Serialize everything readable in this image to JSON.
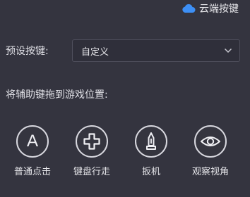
{
  "header": {
    "cloud_keys_label": "云端按键"
  },
  "preset": {
    "label": "预设按键:",
    "selected": "自定义"
  },
  "hint": {
    "text": "将辅助键拖到游戏位置:"
  },
  "keys": [
    {
      "icon": "letter-a-icon",
      "glyph": "A",
      "label": "普通点击"
    },
    {
      "icon": "dpad-icon",
      "label": "键盘行走"
    },
    {
      "icon": "trigger-icon",
      "label": "扳机"
    },
    {
      "icon": "eye-icon",
      "label": "观察视角"
    }
  ],
  "colors": {
    "accent_cloud": "#3d8ff5",
    "background": "#34343f",
    "text": "#e6e6ea"
  }
}
